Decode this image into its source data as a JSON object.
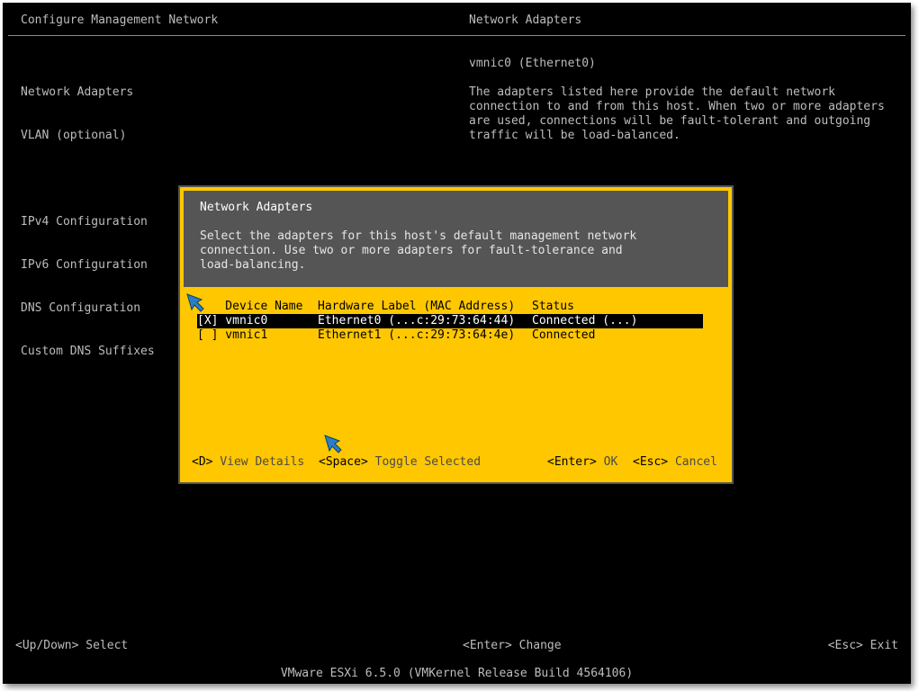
{
  "header": {
    "left_title": "Configure Management Network",
    "right_title": "Network Adapters"
  },
  "menu": {
    "items": [
      "Network Adapters",
      "VLAN (optional)",
      "IPv4 Configuration",
      "IPv6 Configuration",
      "DNS Configuration",
      "Custom DNS Suffixes"
    ]
  },
  "info_panel": {
    "adapter": "vmnic0 (Ethernet0)",
    "description": "The adapters listed here provide the default network\nconnection to and from this host. When two or more adapters\nare used, connections will be fault-tolerant and outgoing\ntraffic will be load-balanced."
  },
  "dialog": {
    "title": "Network Adapters",
    "description": "Select the adapters for this host's default management network\nconnection. Use two or more adapters for fault-tolerance and\nload-balancing.",
    "columns": {
      "device_name": "    Device Name",
      "hardware_label": "Hardware Label (MAC Address)",
      "status": "Status"
    },
    "rows": [
      {
        "device": "[X] vmnic0",
        "hardware": "Ethernet0 (...c:29:73:64:44)",
        "status": "Connected (...)"
      },
      {
        "device": "[ ] vmnic1",
        "hardware": "Ethernet1 (...c:29:73:64:4e)",
        "status": "Connected"
      }
    ],
    "footer": {
      "view_key": "<D>",
      "view_label": "View Details",
      "toggle_key": "<Space>",
      "toggle_label": "Toggle Selected",
      "ok_key": "<Enter>",
      "ok_label": "OK",
      "cancel_key": "<Esc>",
      "cancel_label": "Cancel"
    }
  },
  "bottom_hints": {
    "select": "<Up/Down> Select",
    "change": "<Enter> Change",
    "exit": "<Esc> Exit"
  },
  "status_bar": "VMware ESXi 6.5.0 (VMKernel Release Build 4564106)",
  "colors": {
    "background": "#000000",
    "dialog_bg": "#ffc700",
    "dialog_header": "#555555",
    "annotation_arrow": "#2a7fc4"
  }
}
